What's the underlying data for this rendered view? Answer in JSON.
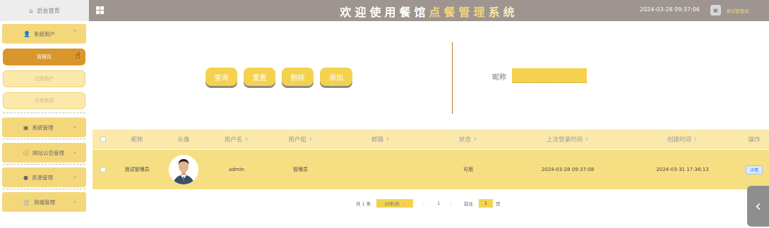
{
  "sidebar": {
    "home_label": "后台首页",
    "menu": [
      {
        "label": "系统用户",
        "icon": "user-icon"
      },
      {
        "label": "系统管理",
        "icon": "image-icon"
      },
      {
        "label": "网站公告管理",
        "icon": "info-icon"
      },
      {
        "label": "资源管理",
        "icon": "pin-icon"
      },
      {
        "label": "商城管理",
        "icon": "cart-icon"
      }
    ],
    "submenu": [
      "管理员",
      "注册用户",
      "注册商家"
    ]
  },
  "header": {
    "title_chars": [
      "欢",
      "迎",
      "使",
      "用",
      "餐",
      "馆",
      "点",
      "餐",
      "管",
      "理",
      "系",
      "统"
    ],
    "title_colors": [
      "#ffffff",
      "#ffffff",
      "#ffffff",
      "#ffffff",
      "#ffffff",
      "#ffffff",
      "#f3d57a",
      "#f3d57a",
      "#f3d57a",
      "#f3d57a",
      "#f6e6a4",
      "#f9efc4"
    ],
    "datetime": "2024-03-28 09:37:06",
    "admin_name": "测试管理员"
  },
  "toolbar": {
    "query": "查询",
    "reset": "重置",
    "delete": "删除",
    "add": "添加",
    "nick_label": "昵称",
    "nick_value": ""
  },
  "table": {
    "headers": [
      "昵称",
      "头像",
      "用户名",
      "用户组",
      "邮箱",
      "状态",
      "上次登录时间",
      "创建时间",
      "操作"
    ],
    "sortable": [
      false,
      false,
      true,
      true,
      true,
      true,
      true,
      true,
      false
    ],
    "rows": [
      {
        "nickname": "测试管理员",
        "username": "admin",
        "group": "管理员",
        "email": "",
        "status": "可用",
        "last_login": "2024-03-28 09:37:08",
        "created": "2024-03-31 17:36:13",
        "action": "详情"
      }
    ]
  },
  "pagination": {
    "total": "共 1 条",
    "page_size": "10条/页",
    "current": "1",
    "goto_label": "前往",
    "goto_value": "1",
    "page_suffix": "页"
  },
  "colors": {
    "accent": "#f4d24f",
    "header": "#9e9590",
    "active": "#d9962a"
  }
}
